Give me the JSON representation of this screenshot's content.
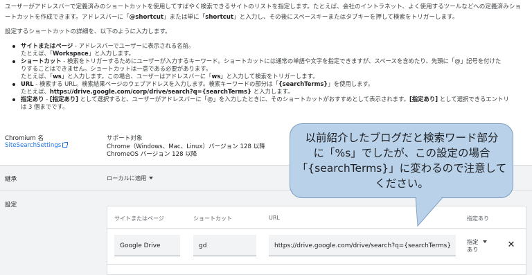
{
  "intro": {
    "line1": "ユーザーがアドレスバーで定義済みのショートカットを使用してすばやく検索できるサイトのリストを指定します。たとえば、会社のイントラネット、よく使用するツールなどへの定義済みショ",
    "line2_a": "ートカットを作成できます。アドレスバーに「",
    "line2_b": "@shortcut",
    "line2_c": "」または単に「",
    "line2_d": "shortcut",
    "line2_e": "」と入力し、その後にスペースキーまたはタブキーを押して検索をトリガーします。"
  },
  "lead": "設定するショートカットの詳細を、以下のように入力します。",
  "details": {
    "site_title": "サイトまたはページ",
    "site_desc": " - アドレスバーでユーザーに表示される名前。",
    "site_ex_a": "たとえば、「",
    "site_ex_b": "Workspace",
    "site_ex_c": "」と入力します。",
    "shortcut_title": "ショートカット",
    "shortcut_desc": " - 検索をトリガーするためにユーザーが入力するキーワード。ショートカットには通常の単語や文字を指定できますが、スペースを含めたり、先頭に「@」記号を付けた",
    "shortcut_desc2": "りすることはできません。ショートカットは一意である必要があります。",
    "shortcut_ex_a": "たとえば、「",
    "shortcut_ex_b": "ws",
    "shortcut_ex_c": "」と入力します。この場合、ユーザーはアドレスバーに「",
    "shortcut_ex_d": "ws",
    "shortcut_ex_e": "」と入力して検索をトリガーします。",
    "url_title": "URL",
    "url_desc_a": " - 検索する URL。検索結果ページのウェブアドレスを入力します。検索キーワードの部分は「",
    "url_desc_b": "{searchTerms}",
    "url_desc_c": "」を使用します。",
    "url_ex_a": "たとえば、",
    "url_ex_b": "https://drive.google.com/corp/drive/search?q={searchTerms}",
    "url_ex_c": " と入力します。",
    "policy_title": "指定あり",
    "policy_desc_a": " - ",
    "policy_desc_b": "[指定あり]",
    "policy_desc_c": " として選択すると、ユーザーがアドレスバーに「@」を入力したときに、そのショートカットがおすすめとして表示されます。",
    "policy_desc_d": "[指定あり]",
    "policy_desc_e": " として選択できるエントリ",
    "policy_desc2": "は 3 個までです。"
  },
  "meta": {
    "chromium_label": "Chromium 名",
    "chromium_link": "SiteSearchSettings",
    "support_label": "サポート対象",
    "support_line1": "Chrome（Windows、Mac、Linux）バージョン 128 以降",
    "support_line2": "ChromeOS バージョン 128 以降"
  },
  "inherit": {
    "label": "継承",
    "value": "ローカルに適用"
  },
  "settings": {
    "label": "設定",
    "headers": [
      "サイトまたはページ",
      "ショートカット",
      "URL",
      "指定あり"
    ],
    "row": {
      "site": "Google Drive",
      "shortcut": "gd",
      "url": "https://drive.google.com/drive/search?q={searchTerms}",
      "policy_l1": "指定",
      "policy_l2": "あり"
    }
  },
  "callout": {
    "line1": "以前紹介したブログだと検索ワード部分",
    "line2": "に「%s」でしたが、この設定の場合",
    "line3": "「{searchTerms}」に変わるので注意して",
    "line4": "ください。"
  },
  "colors": {
    "link": "#1a73e8",
    "callout_fill": "#b9d2ea",
    "band": "#f1f3f4"
  }
}
